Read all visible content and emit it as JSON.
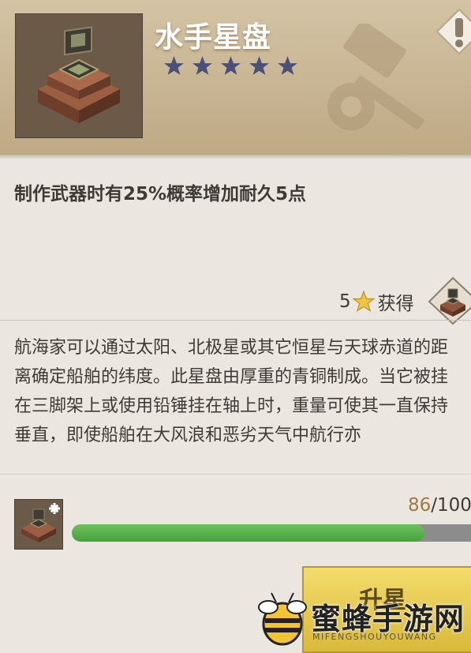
{
  "item": {
    "name": "水手星盘",
    "stars": 5,
    "star_color": "#4a5078",
    "icon": "astrolabe-icon"
  },
  "effect_text": "制作武器时有25%概率增加耐久5点",
  "acquire": {
    "count": "5",
    "label": "获得",
    "star_icon": "gold-star-icon"
  },
  "description": "航海家可以通过太阳、北极星或其它恒星与天球赤道的距离确定船舶的纬度。此星盘由厚重的青铜制成。当它被挂在三脚架上或使用铅锤挂在轴上时，重量可使其一直保持垂直，即使船舶在大风浪和恶劣天气中航行亦",
  "progress": {
    "current": "86",
    "separator": "/",
    "max": "100",
    "fraction": 0.86,
    "bar_color": "#52ad45"
  },
  "upgrade_button": {
    "label": "升星"
  },
  "watermark": {
    "text": "蜜蜂手游网",
    "subtext": "MIFENGSHOUYOUWANG"
  }
}
